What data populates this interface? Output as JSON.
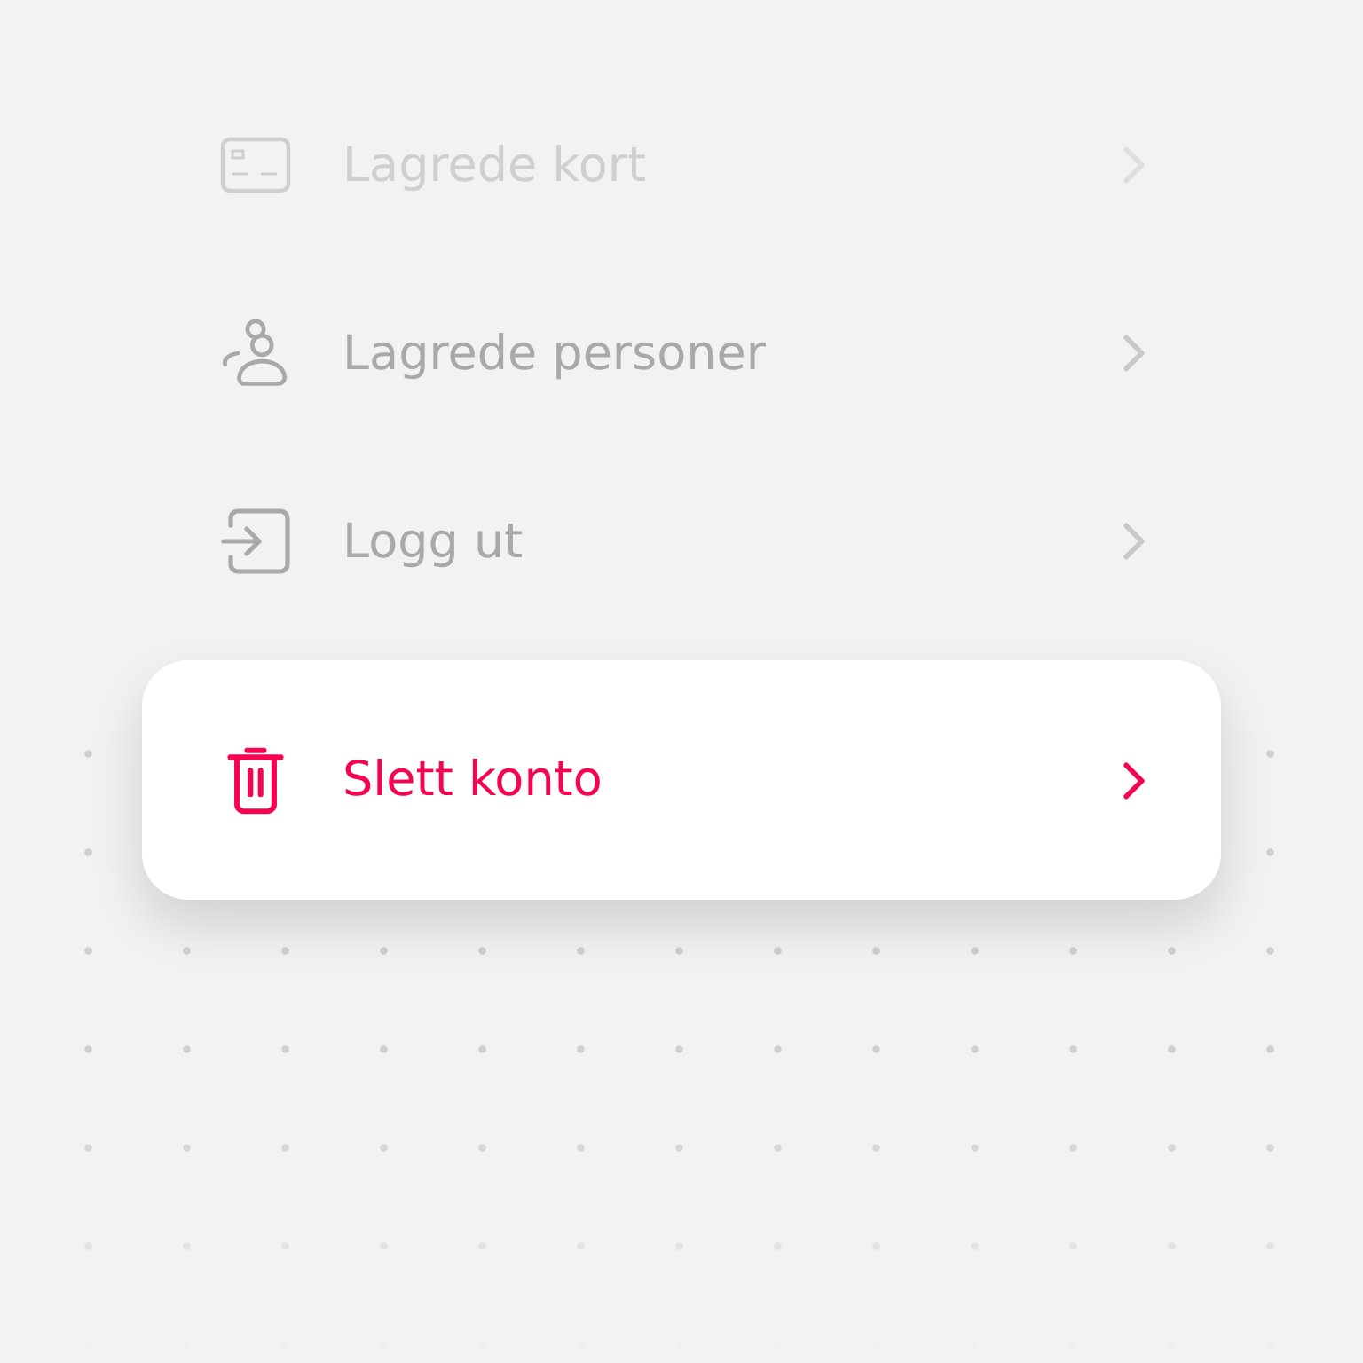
{
  "menu": [
    {
      "label": "Lagrede kort",
      "kind": "card",
      "selected": false
    },
    {
      "label": "Lagrede personer",
      "kind": "people",
      "selected": false
    },
    {
      "label": "Logg ut",
      "kind": "logout",
      "selected": false
    },
    {
      "label": "Slett konto",
      "kind": "trash",
      "selected": true
    }
  ]
}
